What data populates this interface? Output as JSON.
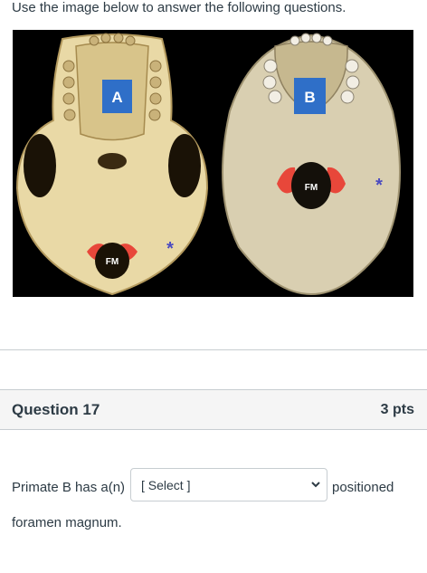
{
  "intro": {
    "text": "Use the image below to answer the following questions."
  },
  "figure": {
    "label_a": "A",
    "label_b": "B",
    "fm_label": "FM",
    "asterisk": "*",
    "colors": {
      "box": "#2f6fc8",
      "highlight": "#e8473a",
      "bone_a": "#e9d9a6",
      "bone_b": "#d9cfb1"
    }
  },
  "question": {
    "title": "Question 17",
    "points": "3 pts",
    "text_before": "Primate B has a(n)",
    "select_value": "[ Select ]",
    "text_after": "positioned",
    "text_continued": "foramen magnum."
  }
}
